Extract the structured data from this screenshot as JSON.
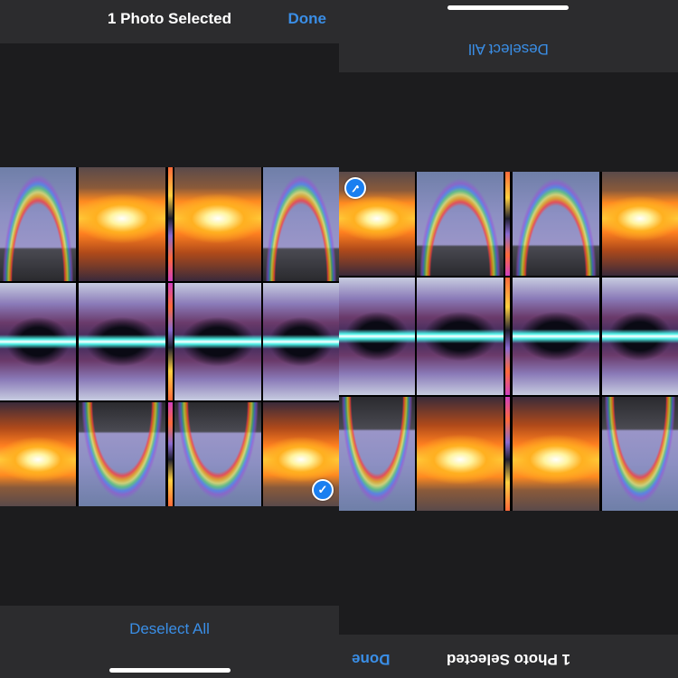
{
  "header": {
    "title": "1 Photo Selected",
    "done_label": "Done"
  },
  "footer": {
    "deselect_label": "Deselect All"
  },
  "selection": {
    "selected_icon": "checkmark-circle-icon",
    "count": 1
  },
  "colors": {
    "accent": "#3a8ee6",
    "bar_background": "#2c2c2e",
    "screen_background": "#1c1c1e",
    "check_fill": "#1a7ff0"
  },
  "grid": {
    "rows": [
      [
        {
          "name": "photo-rainbow",
          "variant": "rainbow",
          "flip": ""
        },
        {
          "name": "photo-sunset",
          "variant": "sunset",
          "flip": ""
        },
        {
          "name": "photo-strip",
          "variant": "strip",
          "flip": ""
        },
        {
          "name": "photo-sunset-mirrored",
          "variant": "sunset",
          "flip": "h"
        },
        {
          "name": "photo-rainbow-mirrored",
          "variant": "rainbow",
          "flip": "h"
        }
      ],
      [
        {
          "name": "photo-neon",
          "variant": "neon",
          "flip": ""
        },
        {
          "name": "photo-neon-split",
          "variant": "neon",
          "flip": "v"
        },
        {
          "name": "photo-strip-dark",
          "variant": "strip",
          "flip": "v"
        },
        {
          "name": "photo-neon-split-mirrored",
          "variant": "neon",
          "flip": "hv"
        },
        {
          "name": "photo-neon-mirrored",
          "variant": "neon",
          "flip": "h"
        }
      ],
      [
        {
          "name": "photo-sunset-flipped",
          "variant": "sunset",
          "flip": "v"
        },
        {
          "name": "photo-rainbow-flipped",
          "variant": "rainbow",
          "flip": "v"
        },
        {
          "name": "photo-strip-flipped",
          "variant": "strip",
          "flip": "hv"
        },
        {
          "name": "photo-rainbow-flipped-mirrored",
          "variant": "rainbow",
          "flip": "hv"
        },
        {
          "name": "photo-sunset-selected",
          "variant": "sunset",
          "flip": "hv",
          "selected": true
        }
      ]
    ]
  }
}
